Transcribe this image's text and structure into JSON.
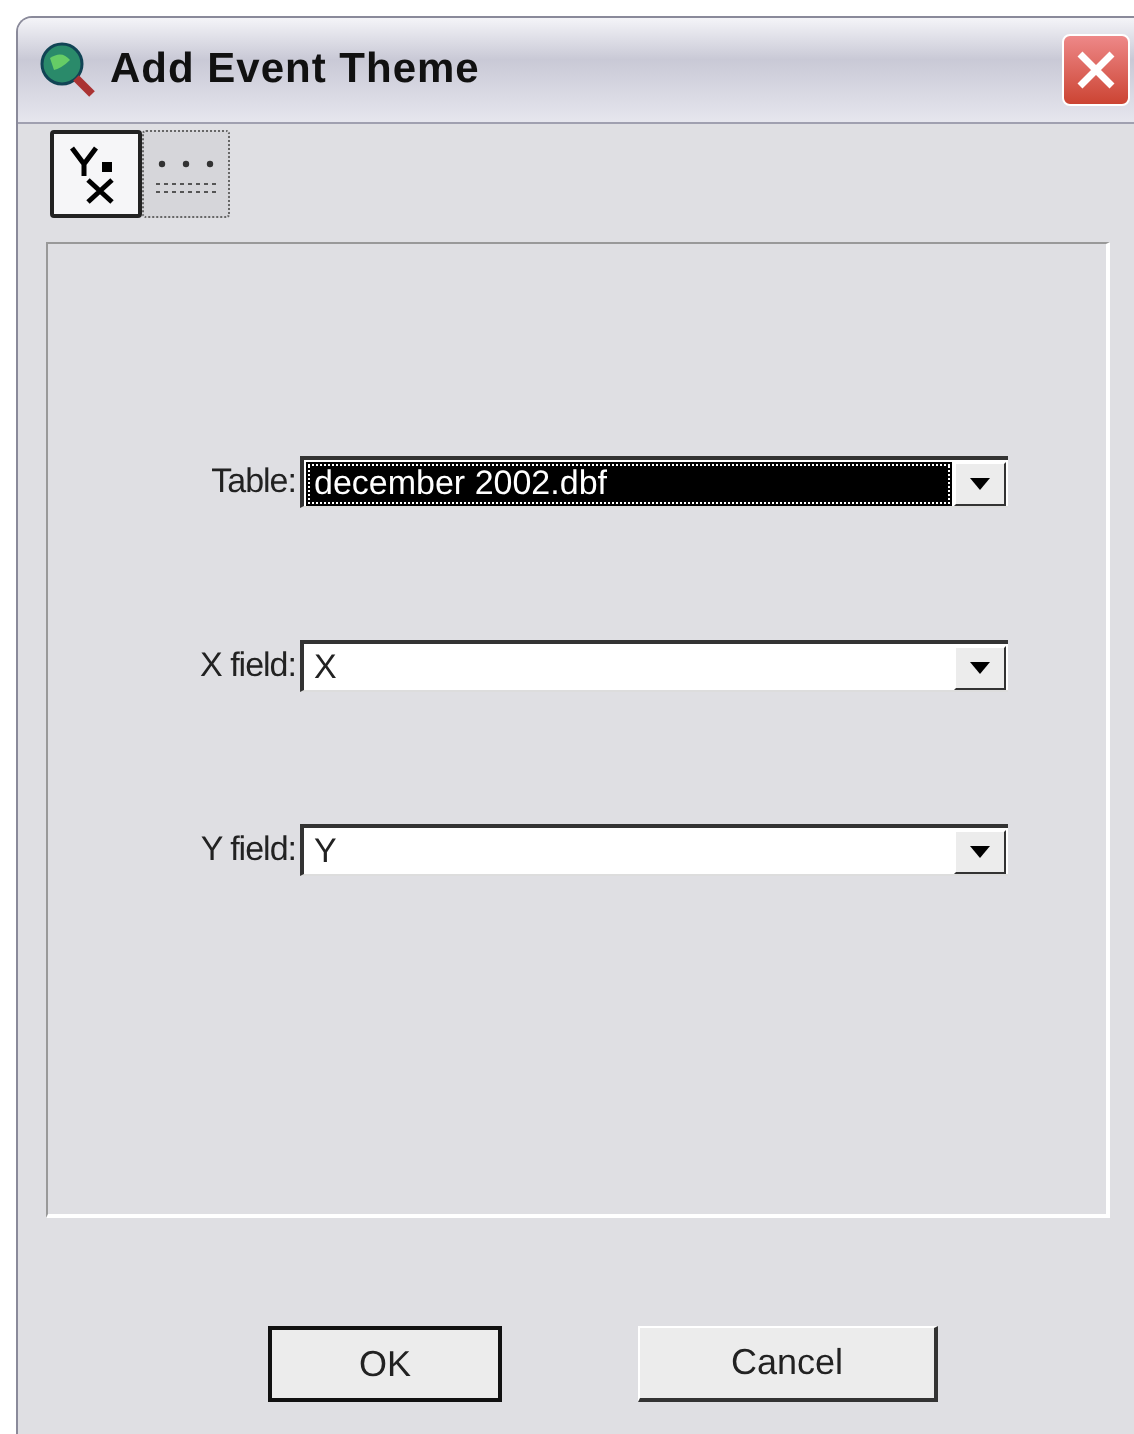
{
  "window": {
    "title": "Add Event Theme"
  },
  "tabs": [
    {
      "kind": "xy",
      "selected": true
    },
    {
      "kind": "address",
      "selected": false
    }
  ],
  "fields": [
    {
      "label": "Table:",
      "value": "december 2002.dbf",
      "focused": true
    },
    {
      "label": "X field:",
      "value": "X",
      "focused": false
    },
    {
      "label": "Y field:",
      "value": "Y",
      "focused": false
    }
  ],
  "buttons": [
    {
      "label": "OK",
      "default": true
    },
    {
      "label": "Cancel",
      "default": false
    }
  ]
}
